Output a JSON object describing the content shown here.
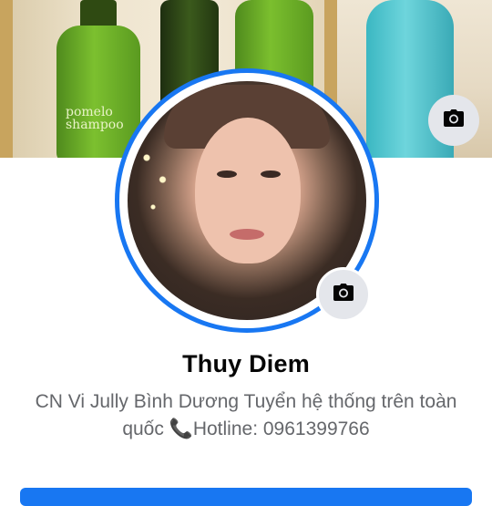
{
  "cover": {
    "product_label": "pomelo\nshampoo"
  },
  "profile": {
    "name": "Thuy Diem",
    "bio": "CN Vi Jully Bình Dương Tuyển hệ thống trên toàn quốc 📞Hotline: 0961399766"
  },
  "icons": {
    "cover_camera": "camera-icon",
    "avatar_camera": "camera-icon"
  },
  "colors": {
    "accent": "#1877f2",
    "name_text": "#050505",
    "bio_text": "#65676b",
    "icon_button_bg": "#e4e6eb"
  }
}
